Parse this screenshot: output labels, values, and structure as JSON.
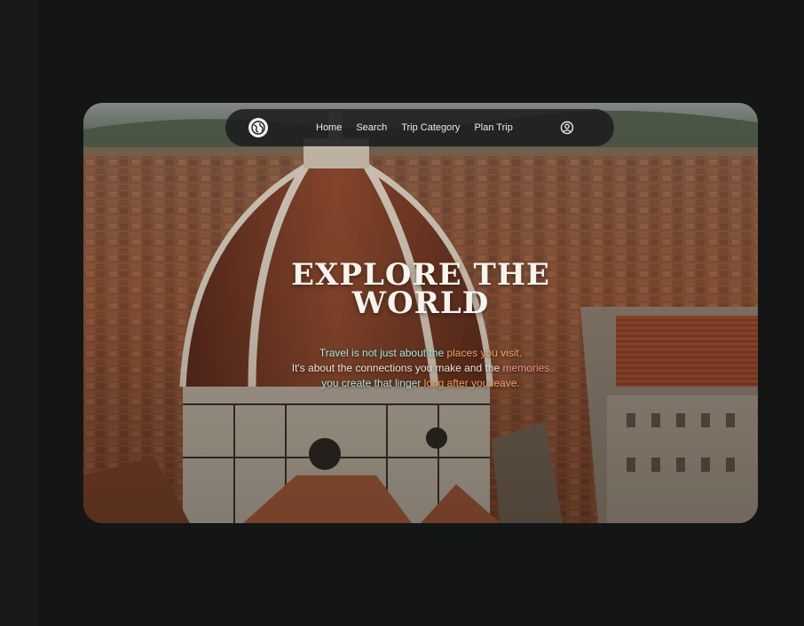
{
  "nav": {
    "logo_icon": "globe-logo-icon",
    "links": [
      "Home",
      "Search",
      "Trip Category",
      "Plan Trip"
    ],
    "user_icon": "user-icon"
  },
  "hero": {
    "title_line1": "Explore the",
    "title_line2": "world",
    "subtitle": {
      "line1_a": "Travel is not just about the ",
      "line1_b": "places you visit.",
      "line2_a": "It's about the connections you make and the ",
      "line2_b": "memories",
      "line3_a": "you create that linger ",
      "line3_b": "long after you leave."
    }
  },
  "colors": {
    "page_bg": "#141616",
    "nav_bg": "#1c1e20",
    "accent_cyan": "#9fe6e0",
    "accent_orange": "#f0a15e",
    "accent_pink": "#f08a8a"
  }
}
